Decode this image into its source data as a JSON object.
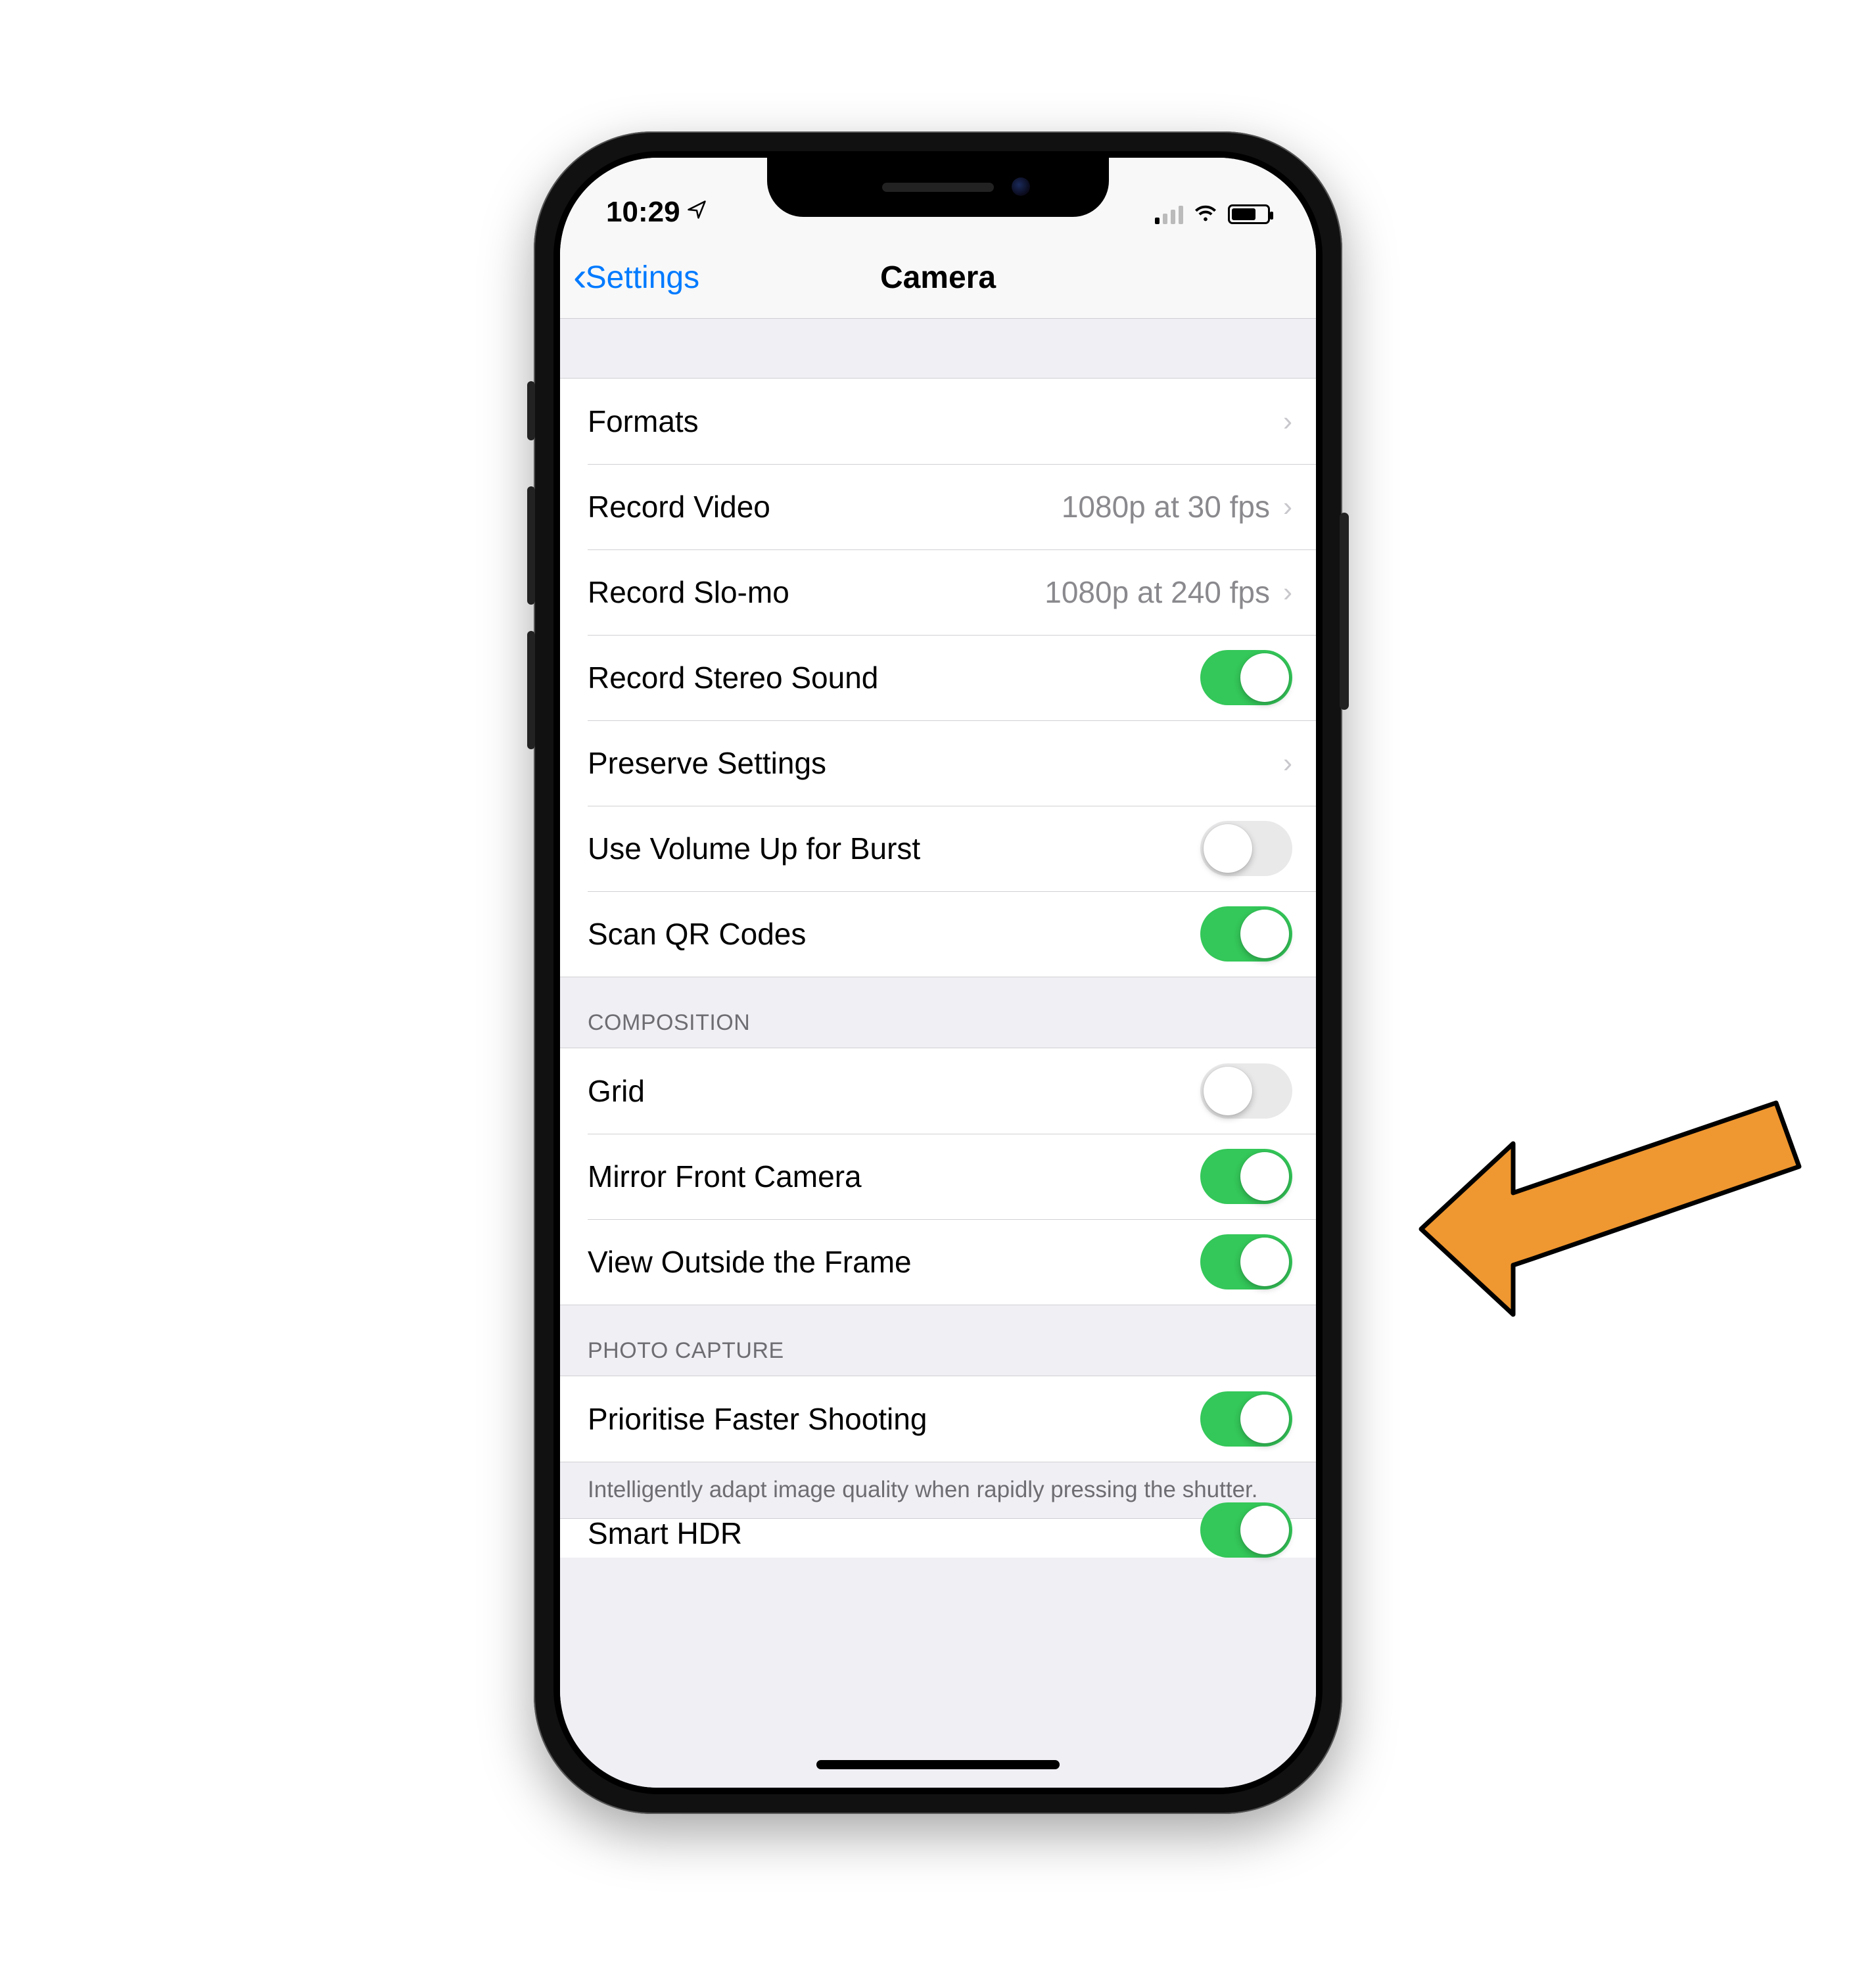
{
  "status": {
    "time": "10:29",
    "location_icon": "location-arrow"
  },
  "nav": {
    "back_label": "Settings",
    "title": "Camera"
  },
  "sections": {
    "main": {
      "rows": {
        "formats": {
          "label": "Formats"
        },
        "record_video": {
          "label": "Record Video",
          "value": "1080p at 30 fps"
        },
        "record_slomo": {
          "label": "Record Slo-mo",
          "value": "1080p at 240 fps"
        },
        "stereo": {
          "label": "Record Stereo Sound",
          "on": true
        },
        "preserve": {
          "label": "Preserve Settings"
        },
        "volume_burst": {
          "label": "Use Volume Up for Burst",
          "on": false
        },
        "qr": {
          "label": "Scan QR Codes",
          "on": true
        }
      }
    },
    "composition": {
      "header": "COMPOSITION",
      "rows": {
        "grid": {
          "label": "Grid",
          "on": false
        },
        "mirror": {
          "label": "Mirror Front Camera",
          "on": true
        },
        "outside": {
          "label": "View Outside the Frame",
          "on": true
        }
      }
    },
    "photo_capture": {
      "header": "PHOTO CAPTURE",
      "rows": {
        "prioritise": {
          "label": "Prioritise Faster Shooting",
          "on": true
        }
      },
      "footer": "Intelligently adapt image quality when rapidly pressing the shutter."
    },
    "partial": {
      "smart_hdr": {
        "label": "Smart HDR",
        "on": true
      }
    }
  },
  "annotation": {
    "target": "mirror-front-camera-toggle",
    "color": "#e8912a"
  }
}
